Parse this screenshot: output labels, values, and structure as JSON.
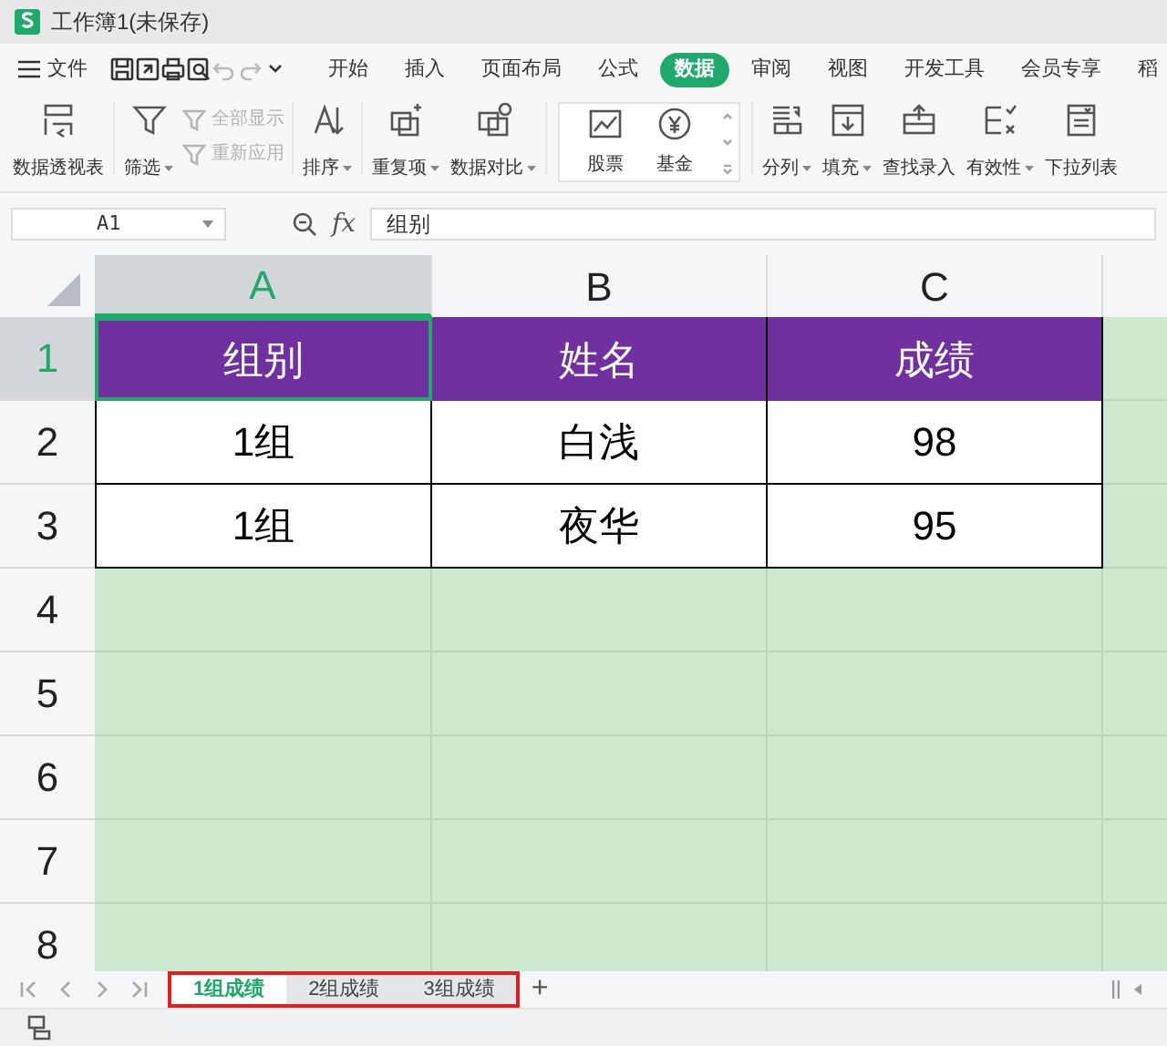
{
  "window": {
    "title": "工作簿1(未保存)"
  },
  "menu": {
    "file": "文件",
    "tabs": [
      {
        "label": "开始",
        "selected": false
      },
      {
        "label": "插入",
        "selected": false
      },
      {
        "label": "页面布局",
        "selected": false
      },
      {
        "label": "公式",
        "selected": false
      },
      {
        "label": "数据",
        "selected": true
      },
      {
        "label": "审阅",
        "selected": false
      },
      {
        "label": "视图",
        "selected": false
      },
      {
        "label": "开发工具",
        "selected": false
      },
      {
        "label": "会员专享",
        "selected": false
      },
      {
        "label": "稻",
        "selected": false
      }
    ]
  },
  "ribbon": [
    {
      "kind": "large",
      "label": "数据透视表",
      "dropdown": false
    },
    {
      "kind": "large",
      "label": "筛选",
      "dropdown": true
    },
    {
      "kind": "stack",
      "items": [
        {
          "label": "全部显示",
          "disabled": true
        },
        {
          "label": "重新应用",
          "disabled": true
        }
      ]
    },
    {
      "kind": "large",
      "label": "排序",
      "dropdown": true
    },
    {
      "kind": "large",
      "label": "重复项",
      "dropdown": true
    },
    {
      "kind": "large",
      "label": "数据对比",
      "dropdown": true
    },
    {
      "kind": "gallery",
      "items": [
        {
          "label": "股票"
        },
        {
          "label": "基金"
        }
      ]
    },
    {
      "kind": "large",
      "label": "分列",
      "dropdown": true
    },
    {
      "kind": "large",
      "label": "填充",
      "dropdown": true
    },
    {
      "kind": "large",
      "label": "查找录入",
      "dropdown": false
    },
    {
      "kind": "large",
      "label": "有效性",
      "dropdown": true
    },
    {
      "kind": "large",
      "label": "下拉列表",
      "dropdown": false
    }
  ],
  "formula_bar": {
    "name_box": "A1",
    "fx": "fx",
    "value": "组别"
  },
  "sheet": {
    "columns": [
      {
        "label": "A",
        "selected": true
      },
      {
        "label": "B",
        "selected": false
      },
      {
        "label": "C",
        "selected": false
      }
    ],
    "rows": [
      {
        "label": "1",
        "selected": true,
        "kind": "header",
        "cells": [
          "组别",
          "姓名",
          "成绩"
        ]
      },
      {
        "label": "2",
        "selected": false,
        "kind": "data",
        "cells": [
          "1组",
          "白浅",
          "98"
        ]
      },
      {
        "label": "3",
        "selected": false,
        "kind": "data",
        "cells": [
          "1组",
          "夜华",
          "95"
        ]
      },
      {
        "label": "4",
        "selected": false,
        "kind": "empty",
        "cells": []
      },
      {
        "label": "5",
        "selected": false,
        "kind": "empty",
        "cells": []
      },
      {
        "label": "6",
        "selected": false,
        "kind": "empty",
        "cells": []
      },
      {
        "label": "7",
        "selected": false,
        "kind": "empty",
        "cells": []
      },
      {
        "label": "8",
        "selected": false,
        "kind": "empty",
        "cells": []
      }
    ]
  },
  "sheet_tabs": {
    "highlighted": true,
    "tabs": [
      {
        "label": "1组成绩",
        "selected": true
      },
      {
        "label": "2组成绩",
        "selected": false
      },
      {
        "label": "3组成绩",
        "selected": false
      }
    ],
    "add": "+"
  }
}
